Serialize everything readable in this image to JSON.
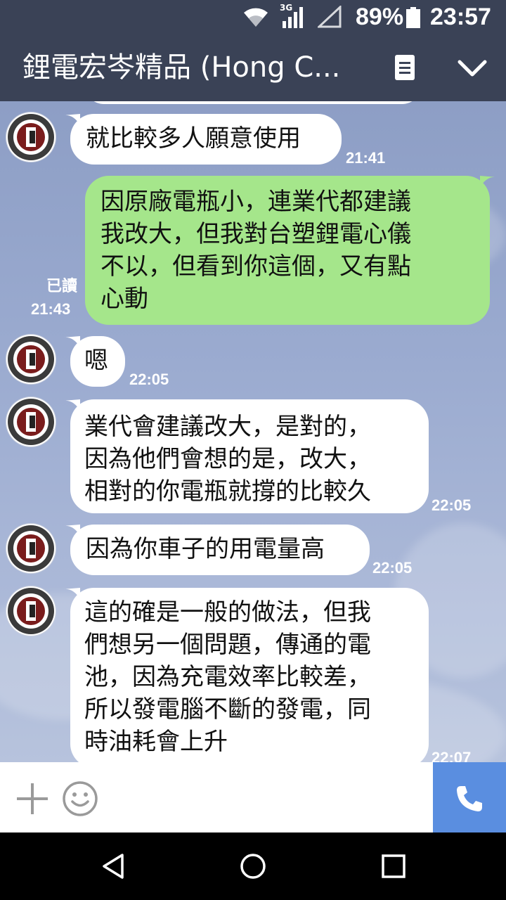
{
  "status_bar": {
    "network_label": "3G",
    "battery_percent": "89%",
    "clock": "23:57"
  },
  "header": {
    "title": "鋰電宏岑精品 (Hong C...",
    "icons": [
      "notes-icon",
      "chevron-down-icon"
    ]
  },
  "messages": [
    {
      "side": "in",
      "text": "就比較多人願意使用",
      "time": "21:41"
    },
    {
      "side": "out",
      "lines": [
        "因原廠電瓶小，連業代都建議",
        "我改大，但我對台塑鋰電心儀",
        "不以，但看到你這個，又有點",
        "心動"
      ],
      "read": "已讀",
      "time": "21:43"
    },
    {
      "side": "in",
      "text": "嗯",
      "time": "22:05"
    },
    {
      "side": "in",
      "lines": [
        "業代會建議改大，是對的，",
        "因為他們會想的是，改大，",
        "相對的你電瓶就撐的比較久"
      ],
      "time": "22:05"
    },
    {
      "side": "in",
      "text": "因為你車子的用電量高",
      "time": "22:05"
    },
    {
      "side": "in",
      "lines": [
        "這的確是一般的做法，但我",
        "們想另一個問題，傳通的電",
        "池，因為充電效率比較差，",
        "所以發電腦不斷的發電，同",
        "時油耗會上升"
      ],
      "time": "22:07"
    }
  ],
  "input_bar": {
    "icons": [
      "plus-icon",
      "emoji-icon",
      "phone-icon"
    ],
    "accent_color": "#5a8ee0"
  },
  "colors": {
    "header_bg": "#3a4256",
    "bubble_out": "#a5e68b",
    "bubble_in": "#ffffff"
  }
}
